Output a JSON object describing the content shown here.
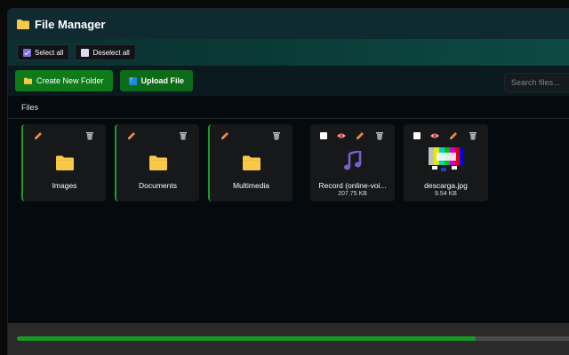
{
  "app": {
    "title": "File Manager"
  },
  "selection": {
    "select_all_label": "Select all",
    "deselect_all_label": "Deselect all"
  },
  "actions": {
    "create_folder_label": "Create New Folder",
    "upload_label": "Upload File"
  },
  "search": {
    "placeholder": "Search files..."
  },
  "section": {
    "title": "Files"
  },
  "items": [
    {
      "type": "folder",
      "name": "Images"
    },
    {
      "type": "folder",
      "name": "Documents"
    },
    {
      "type": "folder",
      "name": "Multimedia"
    },
    {
      "type": "audio",
      "name": "Record (online-voi...",
      "size": "207.75 KB"
    },
    {
      "type": "image",
      "name": "descarga.jpg",
      "size": "9.54 KB"
    }
  ],
  "progress": {
    "fraction": 0.83
  },
  "colors": {
    "accent_green": "#0f7a1a",
    "folder_yellow": "#f7c948",
    "audio_purple": "#7b5fd0",
    "edit_orange": "#ff7a45"
  }
}
